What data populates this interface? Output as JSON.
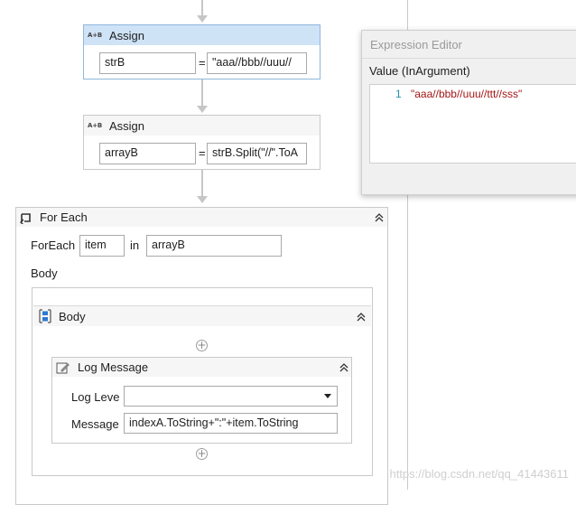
{
  "assign1": {
    "title": "Assign",
    "icon": "assign-icon",
    "to": "strB",
    "equals": "=",
    "value": "\"aaa//bbb//uuu//"
  },
  "assign2": {
    "title": "Assign",
    "icon": "assign-icon",
    "to": "arrayB",
    "equals": "=",
    "value": "strB.Split(\"//\".ToA"
  },
  "foreach": {
    "title": "For Each",
    "foreach_label": "ForEach",
    "item": "item",
    "in_label": "in",
    "collection": "arrayB",
    "body_label": "Body"
  },
  "sequence": {
    "title": "Body"
  },
  "log_message": {
    "title": "Log Message",
    "level_label": "Log Leve",
    "level_value": "",
    "message_label": "Message",
    "message_value": "indexA.ToString+\":\"+item.ToString"
  },
  "expression_editor": {
    "title": "Expression Editor",
    "value_label": "Value (InArgument)",
    "line_number": "1",
    "code": "\"aaa//bbb//uuu//ttt//sss\""
  },
  "watermark": "https://blog.csdn.net/qq_41443611",
  "colors": {
    "selected_header": "#cfe3f7",
    "selected_border": "#8fb6dc",
    "string_literal": "#a31515",
    "line_number": "#2b91af"
  }
}
